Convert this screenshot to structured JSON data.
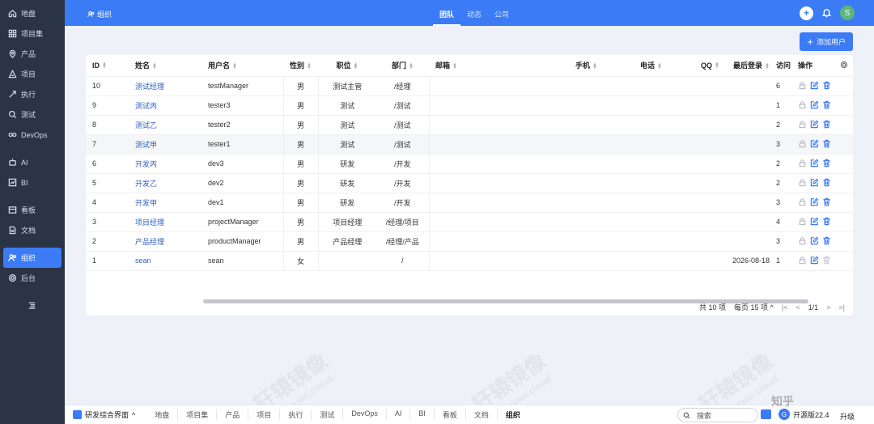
{
  "sidebar": {
    "items": [
      {
        "label": "地盘",
        "icon": "home-icon"
      },
      {
        "label": "项目集",
        "icon": "grid-icon"
      },
      {
        "label": "产品",
        "icon": "pin-icon"
      },
      {
        "label": "项目",
        "icon": "project-icon"
      },
      {
        "label": "执行",
        "icon": "run-icon"
      },
      {
        "label": "测试",
        "icon": "search-icon"
      },
      {
        "label": "DevOps",
        "icon": "infinity-icon"
      },
      {
        "label": "AI",
        "icon": "robot-icon"
      },
      {
        "label": "BI",
        "icon": "chart-icon"
      },
      {
        "label": "看板",
        "icon": "kanban-icon"
      },
      {
        "label": "文档",
        "icon": "doc-icon"
      },
      {
        "label": "组织",
        "icon": "people-icon"
      },
      {
        "label": "后台",
        "icon": "gear-icon"
      }
    ]
  },
  "topbar": {
    "breadcrumb": "组织",
    "tabs": [
      "团队",
      "动态",
      "公司"
    ],
    "active_tab": "团队",
    "add_icon": "plus-icon",
    "bell_icon": "bell-icon",
    "avatar_letter": "S"
  },
  "main": {
    "add_user_label": "添加用户",
    "columns": [
      "ID",
      "姓名",
      "用户名",
      "性别",
      "职位",
      "部门",
      "邮箱",
      "手机",
      "电话",
      "QQ",
      "最后登录",
      "访问",
      "操作"
    ],
    "rows": [
      {
        "id": "10",
        "name": "测试经理",
        "username": "testManager",
        "gender": "男",
        "position": "测试主管",
        "dept": "/经理",
        "last_login": "",
        "visits": "6"
      },
      {
        "id": "9",
        "name": "测试丙",
        "username": "tester3",
        "gender": "男",
        "position": "测试",
        "dept": "/测试",
        "last_login": "",
        "visits": "1"
      },
      {
        "id": "8",
        "name": "测试乙",
        "username": "tester2",
        "gender": "男",
        "position": "测试",
        "dept": "/测试",
        "last_login": "",
        "visits": "2"
      },
      {
        "id": "7",
        "name": "测试甲",
        "username": "tester1",
        "gender": "男",
        "position": "测试",
        "dept": "/测试",
        "last_login": "",
        "visits": "3"
      },
      {
        "id": "6",
        "name": "开发丙",
        "username": "dev3",
        "gender": "男",
        "position": "研发",
        "dept": "/开发",
        "last_login": "",
        "visits": "2"
      },
      {
        "id": "5",
        "name": "开发乙",
        "username": "dev2",
        "gender": "男",
        "position": "研发",
        "dept": "/开发",
        "last_login": "",
        "visits": "2"
      },
      {
        "id": "4",
        "name": "开发甲",
        "username": "dev1",
        "gender": "男",
        "position": "研发",
        "dept": "/开发",
        "last_login": "",
        "visits": "3"
      },
      {
        "id": "3",
        "name": "项目经理",
        "username": "projectManager",
        "gender": "男",
        "position": "项目经理",
        "dept": "/经理/项目",
        "last_login": "",
        "visits": "4"
      },
      {
        "id": "2",
        "name": "产品经理",
        "username": "productManager",
        "gender": "男",
        "position": "产品经理",
        "dept": "/经理/产品",
        "last_login": "",
        "visits": "3"
      },
      {
        "id": "1",
        "name": "sean",
        "username": "sean",
        "gender": "女",
        "position": "",
        "dept": "/",
        "last_login": "2026-08-18",
        "visits": "1"
      }
    ],
    "pager": {
      "total": "共 10 项",
      "per_page": "每页 15 项",
      "page": "1/1"
    }
  },
  "watermark": {
    "text": "轩辕镜像",
    "sub": "xuanyuan.cloud"
  },
  "bottombar": {
    "app_label": "研发综合界面",
    "nav": [
      "地盘",
      "项目集",
      "产品",
      "项目",
      "执行",
      "测试",
      "DevOps",
      "AI",
      "BI",
      "看板",
      "文档",
      "组织"
    ],
    "active_nav": "组织",
    "search_label": "搜索",
    "version_label": "开源版22.4",
    "upgrade_label": "升级"
  },
  "colors": {
    "accent": "#3b7bf5",
    "sidebar_bg": "#2b3445",
    "link": "#2e5fc1"
  }
}
